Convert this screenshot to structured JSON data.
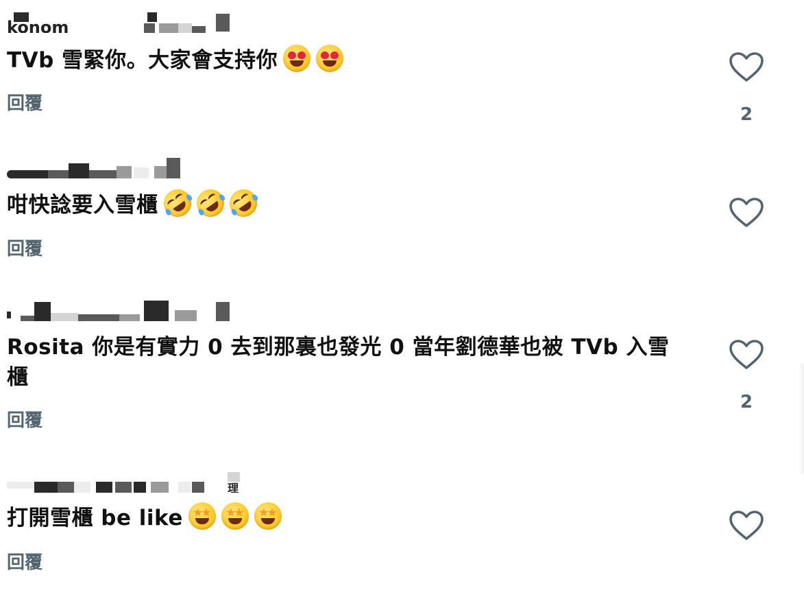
{
  "comments": [
    {
      "text": "TVb 雪緊你。大家會支持你",
      "emojis": [
        "heart-eyes",
        "heart-eyes"
      ],
      "reply_label": "回覆",
      "likes": "2"
    },
    {
      "text": "咁快諗要入雪櫃",
      "emojis": [
        "rolling-laughing",
        "rolling-laughing",
        "rolling-laughing"
      ],
      "reply_label": "回覆",
      "likes": ""
    },
    {
      "text": "Rosita 你是有實力 0 去到那裏也發光 0 當年劉德華也被 TVb 入雪櫃",
      "emojis": [],
      "reply_label": "回覆",
      "likes": "2"
    },
    {
      "text": "打開雪櫃 be like",
      "emojis": [
        "star-struck",
        "star-struck",
        "star-struck"
      ],
      "reply_label": "回覆",
      "likes": ""
    }
  ],
  "colors": {
    "text": "#111111",
    "secondary": "#536471",
    "heart_outline": "#536471"
  }
}
